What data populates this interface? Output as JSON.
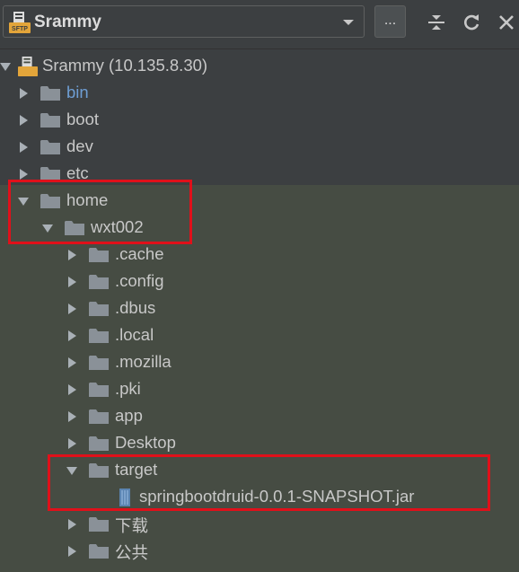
{
  "toolbar": {
    "server_name": "Srammy",
    "sftp_badge": "SFTP",
    "more_label": "...",
    "icons": [
      "collapse-all-icon",
      "refresh-icon",
      "close-icon"
    ]
  },
  "tree": {
    "root": {
      "label": "Srammy (10.135.8.30)",
      "icon": "sftp-server-icon"
    },
    "rows": [
      {
        "label": "bin",
        "type": "folder",
        "expanded": false,
        "color": "#6e9ed4"
      },
      {
        "label": "boot",
        "type": "folder",
        "expanded": false
      },
      {
        "label": "dev",
        "type": "folder",
        "expanded": false
      },
      {
        "label": "etc",
        "type": "folder",
        "expanded": false
      },
      {
        "label": "home",
        "type": "folder",
        "expanded": true
      },
      {
        "label": "wxt002",
        "type": "folder",
        "expanded": true
      },
      {
        "label": ".cache",
        "type": "folder",
        "expanded": false
      },
      {
        "label": ".config",
        "type": "folder",
        "expanded": false
      },
      {
        "label": ".dbus",
        "type": "folder",
        "expanded": false
      },
      {
        "label": ".local",
        "type": "folder",
        "expanded": false
      },
      {
        "label": ".mozilla",
        "type": "folder",
        "expanded": false
      },
      {
        "label": ".pki",
        "type": "folder",
        "expanded": false
      },
      {
        "label": "app",
        "type": "folder",
        "expanded": false
      },
      {
        "label": "Desktop",
        "type": "folder",
        "expanded": false
      },
      {
        "label": "target",
        "type": "folder",
        "expanded": true
      },
      {
        "label": "springbootdruid-0.0.1-SNAPSHOT.jar",
        "type": "jar-file"
      },
      {
        "label": "下载",
        "type": "folder",
        "expanded": false
      },
      {
        "label": "公共",
        "type": "folder",
        "expanded": false
      }
    ]
  },
  "colors": {
    "highlight_box": "#e0101a",
    "folder": "#8a9198",
    "selected_text": "#6e9ed4"
  }
}
